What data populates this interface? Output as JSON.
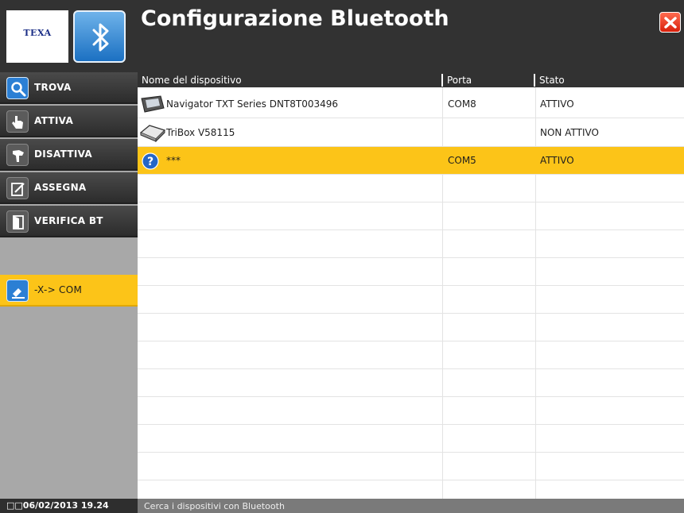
{
  "header": {
    "brand": "TEXA",
    "title": "Configurazione Bluetooth"
  },
  "sidebar": {
    "items": [
      {
        "label": "TROVA",
        "icon": "search-icon"
      },
      {
        "label": "ATTIVA",
        "icon": "hand-pointing-icon"
      },
      {
        "label": "DISATTIVA",
        "icon": "hand-stop-icon"
      },
      {
        "label": "ASSEGNA",
        "icon": "edit-icon"
      },
      {
        "label": "VERIFICA BT",
        "icon": "door-icon"
      }
    ],
    "selected_item": {
      "label": "-X-> COM",
      "icon": "pen-icon"
    }
  },
  "table": {
    "columns": [
      "Nome del dispositivo",
      "Porta",
      "Stato"
    ],
    "rows": [
      {
        "name": "Navigator TXT Series DNT8T003496",
        "port": "COM8",
        "status": "ATTIVO",
        "icon": "navigator-device-icon"
      },
      {
        "name": "TriBox V58115",
        "port": "",
        "status": "NON ATTIVO",
        "icon": "tribox-device-icon"
      },
      {
        "name": "***",
        "port": "COM5",
        "status": "ATTIVO",
        "icon": "question-icon",
        "highlighted": true
      }
    ]
  },
  "statusbar": {
    "datetime": "□□06/02/2013 19.24",
    "message": "Cerca i dispositivi con Bluetooth"
  },
  "colors": {
    "accent": "#fcc418",
    "header_bg": "#323232",
    "sidebar_bg": "#a8a8a8",
    "close": "#e0321a",
    "bluetooth": "#2b7fd4"
  }
}
